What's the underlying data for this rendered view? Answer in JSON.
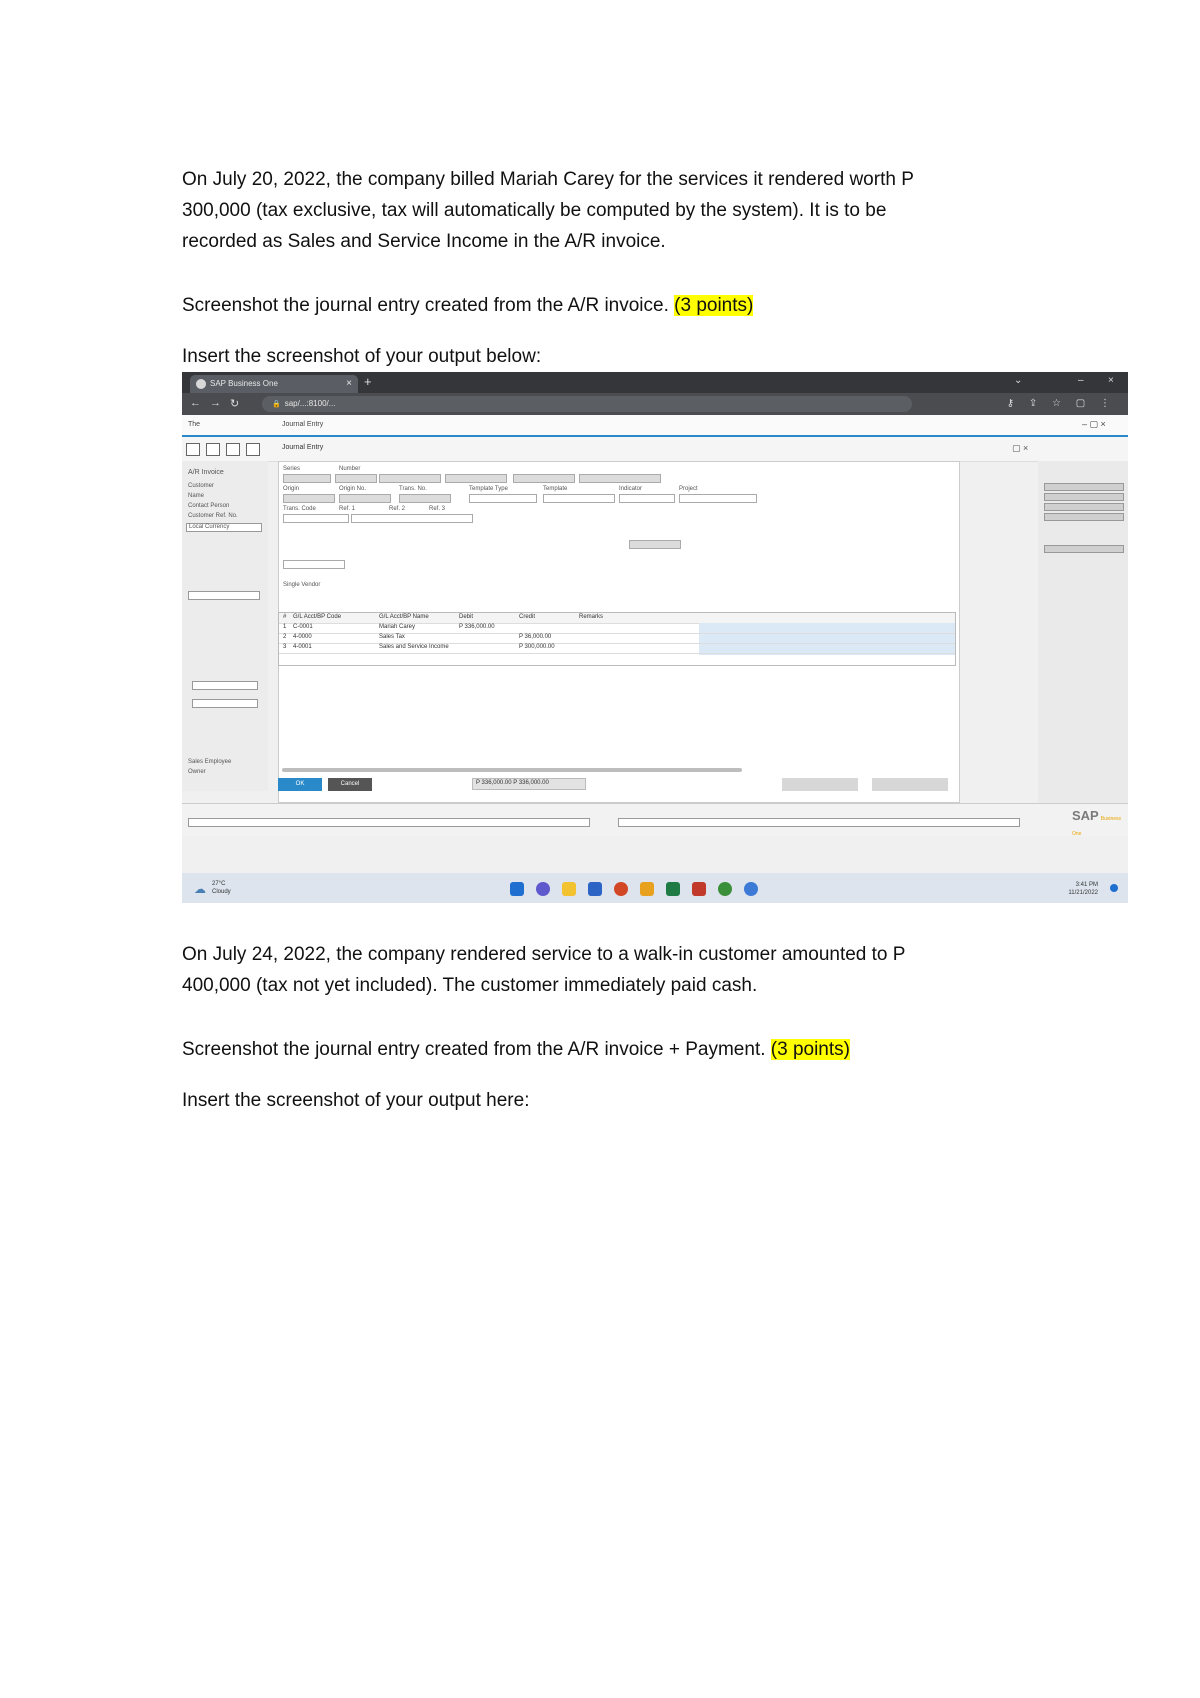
{
  "doc": {
    "p1_line1": "On July 20, 2022, the company billed Mariah Carey for the services it rendered worth P",
    "p1_line2": "300,000 (tax exclusive, tax will automatically be computed by the system). It is to be",
    "p1_line3": "recorded as Sales and Service Income in the A/R invoice.",
    "p2_text": "Screenshot the journal entry created from the A/R invoice. ",
    "p2_points": "(3 points)",
    "p3": "Insert the screenshot of your output below:",
    "p4_line1": "On July 24, 2022, the company rendered service to a walk-in customer amounted to P",
    "p4_line2": "400,000 (tax not yet included). The customer immediately paid cash.",
    "p5_text": "Screenshot the journal entry created from the A/R invoice + Payment. ",
    "p5_points": "(3 points)",
    "p6": "Insert the screenshot of your output here:"
  },
  "screenshot": {
    "tab_title": "SAP Business One",
    "url": "sap/...:8100/...",
    "menu_home": "The",
    "window_title": "Journal Entry",
    "left_title": "A/R Invoice",
    "left_labels": [
      "Customer",
      "Name",
      "Contact Person",
      "Customer Ref. No.",
      "Local Currency"
    ],
    "left_labels_lower": [
      "Sales Employee",
      "Owner"
    ],
    "header_labels": [
      "Series",
      "Number",
      "Origin",
      "Origin No.",
      "Trans. No.",
      "Template Type",
      "Template",
      "Indicator",
      "Project",
      "Trans. Code",
      "Ref. 1",
      "Ref. 2",
      "Ref. 3"
    ],
    "grid_title": "Single Vendor",
    "grid_header": [
      "#",
      "G/L Acct/BP Code",
      "G/L Acct/BP Name",
      "Debit",
      "Credit",
      "Remarks"
    ],
    "grid_rows": [
      [
        "1",
        "C-0001",
        "Mariah Carey",
        "P 336,000.00",
        "",
        ""
      ],
      [
        "2",
        "4-0000",
        "Sales Tax",
        "",
        "P 36,000.00",
        ""
      ],
      [
        "3",
        "4-0001",
        "Sales and Service Income",
        "",
        "P 300,000.00",
        ""
      ]
    ],
    "totals": "P 336,000.00   P 336,000.00",
    "ok": "OK",
    "cancel": "Cancel",
    "sap_logo": "SAP",
    "sap_logo_sub": "Business One",
    "weather_temp": "27°C",
    "weather_text": "Cloudy",
    "clock_time": "3:41 PM",
    "clock_date": "11/21/2022"
  }
}
